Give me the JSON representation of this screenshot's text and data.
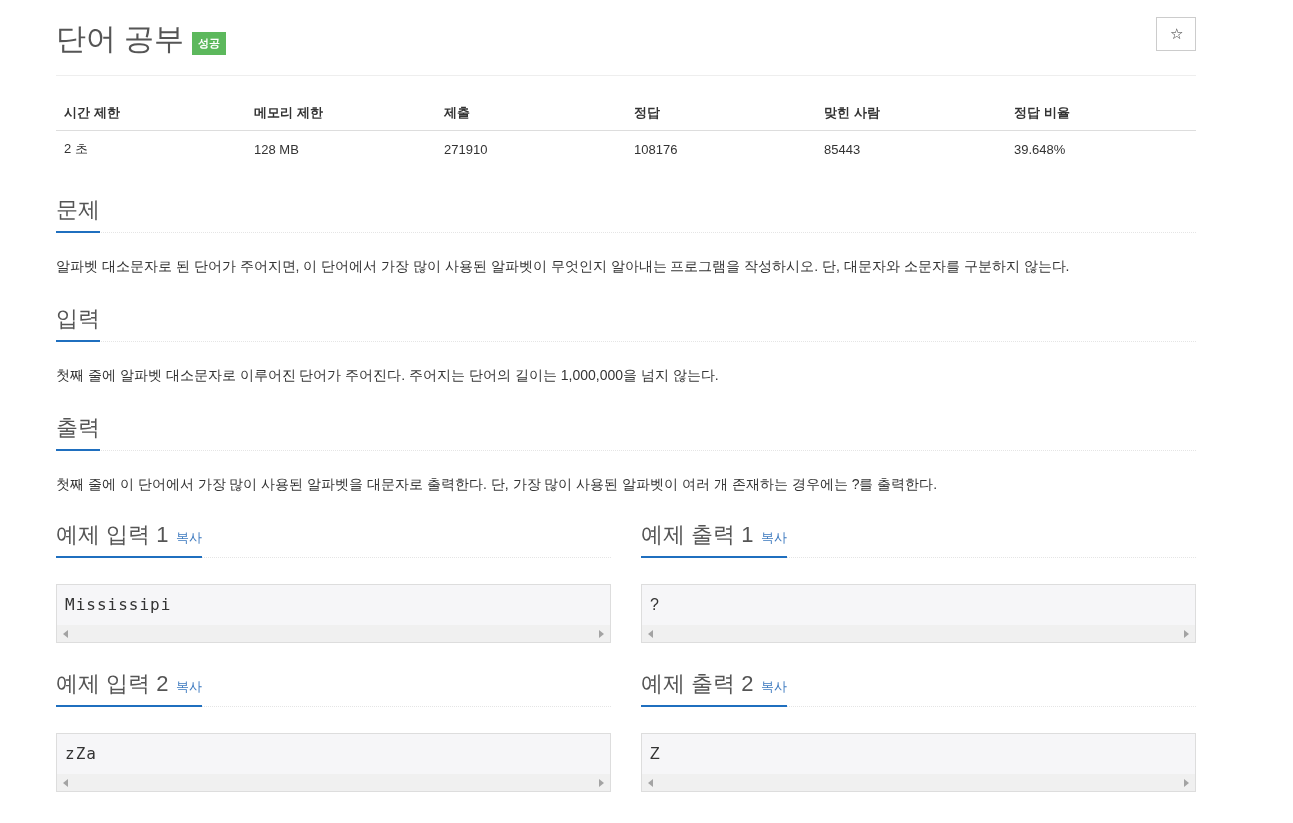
{
  "title": "단어 공부",
  "result_badge": "성공",
  "star_button": "☆",
  "info_table": {
    "columns": [
      "시간 제한",
      "메모리 제한",
      "제출",
      "정답",
      "맞힌 사람",
      "정답 비율"
    ],
    "rows": [
      [
        "2 초",
        "128 MB",
        "271910",
        "108176",
        "85443",
        "39.648%"
      ]
    ]
  },
  "sections": [
    {
      "heading": "문제",
      "text": "알파벳 대소문자로 된 단어가 주어지면, 이 단어에서 가장 많이 사용된 알파벳이 무엇인지 알아내는 프로그램을 작성하시오. 단, 대문자와 소문자를 구분하지 않는다."
    },
    {
      "heading": "입력",
      "text": "첫째 줄에 알파벳 대소문자로 이루어진 단어가 주어진다. 주어지는 단어의 길이는 1,000,000을 넘지 않는다."
    },
    {
      "heading": "출력",
      "text": "첫째 줄에 이 단어에서 가장 많이 사용된 알파벳을 대문자로 출력한다. 단, 가장 많이 사용된 알파벳이 여러 개 존재하는 경우에는 ?를 출력한다."
    }
  ],
  "samples": [
    {
      "input_heading": "예제 입력 1",
      "input_copy": "복사",
      "input": "Mississipi",
      "output_heading": "예제 출력 1",
      "output_copy": "복사",
      "output": "?"
    },
    {
      "input_heading": "예제 입력 2",
      "input_copy": "복사",
      "input": "zZa",
      "output_heading": "예제 출력 2",
      "output_copy": "복사",
      "output": "Z"
    }
  ]
}
